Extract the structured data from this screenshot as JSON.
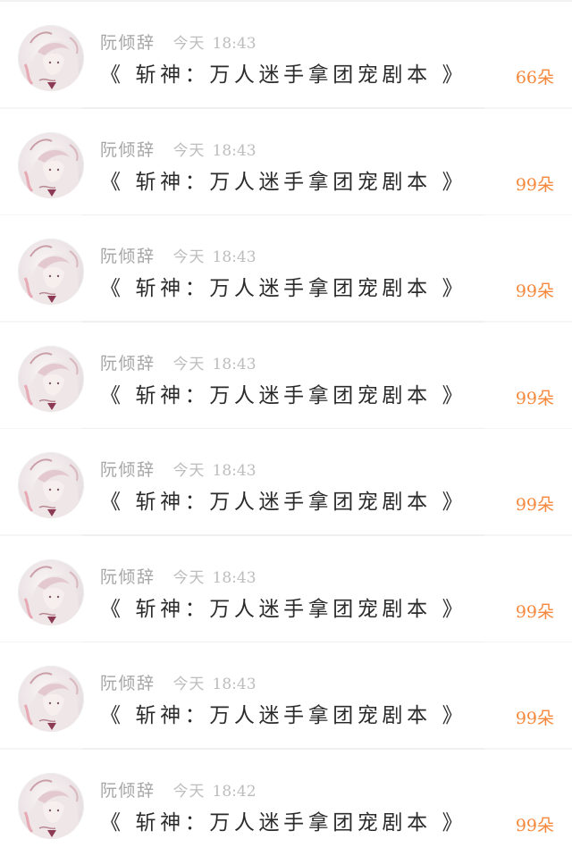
{
  "messages": [
    {
      "name": "阮倾辞",
      "day": "今天",
      "time": "18:43",
      "title": "《 斩神：万人迷手拿团宠剧本 》",
      "count": "66朵"
    },
    {
      "name": "阮倾辞",
      "day": "今天",
      "time": "18:43",
      "title": "《 斩神：万人迷手拿团宠剧本 》",
      "count": "99朵"
    },
    {
      "name": "阮倾辞",
      "day": "今天",
      "time": "18:43",
      "title": "《 斩神：万人迷手拿团宠剧本 》",
      "count": "99朵"
    },
    {
      "name": "阮倾辞",
      "day": "今天",
      "time": "18:43",
      "title": "《 斩神：万人迷手拿团宠剧本 》",
      "count": "99朵"
    },
    {
      "name": "阮倾辞",
      "day": "今天",
      "time": "18:43",
      "title": "《 斩神：万人迷手拿团宠剧本 》",
      "count": "99朵"
    },
    {
      "name": "阮倾辞",
      "day": "今天",
      "time": "18:43",
      "title": "《 斩神：万人迷手拿团宠剧本 》",
      "count": "99朵"
    },
    {
      "name": "阮倾辞",
      "day": "今天",
      "time": "18:43",
      "title": "《 斩神：万人迷手拿团宠剧本 》",
      "count": "99朵"
    },
    {
      "name": "阮倾辞",
      "day": "今天",
      "time": "18:42",
      "title": "《 斩神：万人迷手拿团宠剧本 》",
      "count": "99朵"
    }
  ],
  "colors": {
    "accent": "#f5883c",
    "name_text": "#a6a6a6",
    "time_text": "#bdbdbd",
    "title_text": "#2b2b2b"
  }
}
